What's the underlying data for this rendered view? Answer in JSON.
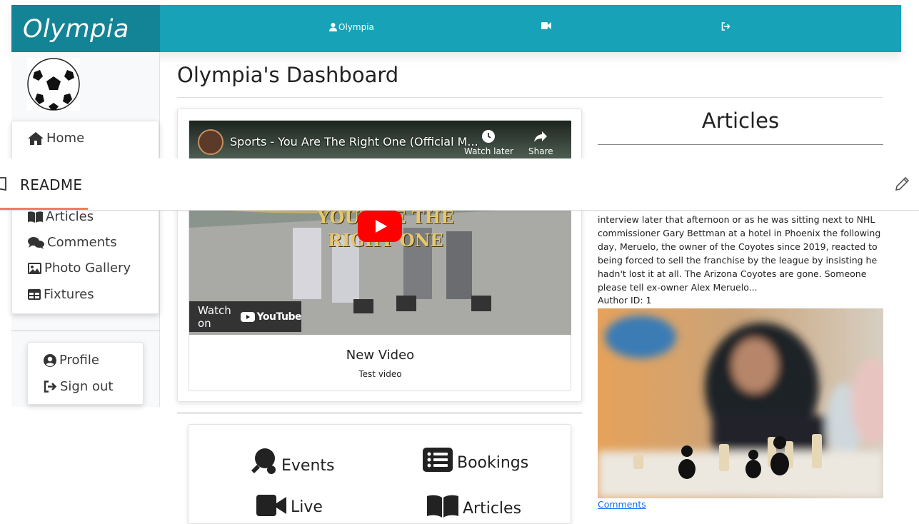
{
  "brand": "Olympia",
  "nav": {
    "user_label": "Olympia",
    "video_icon": "video-icon",
    "signout_icon": "sign-out-icon"
  },
  "sidebar": {
    "items": [
      {
        "label": "Home",
        "icon": "home-icon"
      },
      {
        "label": "Articles",
        "icon": "book-icon"
      },
      {
        "label": "Comments",
        "icon": "comments-icon"
      },
      {
        "label": "Photo Gallery",
        "icon": "image-icon"
      },
      {
        "label": "Fixtures",
        "icon": "table-icon"
      }
    ],
    "profile": {
      "label": "Profile",
      "icon": "user-circle-icon"
    },
    "signout": {
      "label": "Sign out",
      "icon": "sign-out-icon"
    }
  },
  "main": {
    "title": "Olympia's Dashboard",
    "video": {
      "embed_title": "Sports - You Are The Right One (Official M...",
      "watch_later": "Watch later",
      "share": "Share",
      "overlay_line1": "YOU ARE THE",
      "overlay_line2": "RIGHT ONE",
      "watch_on": "Watch on",
      "youtube": "YouTube",
      "name": "New Video",
      "description": "Test video"
    },
    "quick_links": [
      {
        "label": "Events",
        "icon": "ping-pong-icon"
      },
      {
        "label": "Bookings",
        "icon": "list-icon"
      },
      {
        "label": "Live",
        "icon": "video-icon"
      },
      {
        "label": "Articles",
        "icon": "book-icon"
      }
    ]
  },
  "articles": {
    "heading": "Articles",
    "excerpt": "interview later that afternoon or as he was sitting next to NHL commissioner Gary Bettman at a hotel in Phoenix the following day, Meruelo, the owner of the Coyotes since 2019, reacted to being forced to sell the franchise by the league by insisting he hadn't lost it at all. The Arizona Coyotes are gone. Someone please tell ex-owner Alex Meruelo...",
    "author": "Author ID: 1",
    "comments_link": "Comments"
  },
  "readme": {
    "label": "README"
  },
  "colors": {
    "topbar": "#17a2b8",
    "brand_bg": "#138496",
    "readme_accent": "#f47c5c",
    "link": "#0d6efd"
  }
}
